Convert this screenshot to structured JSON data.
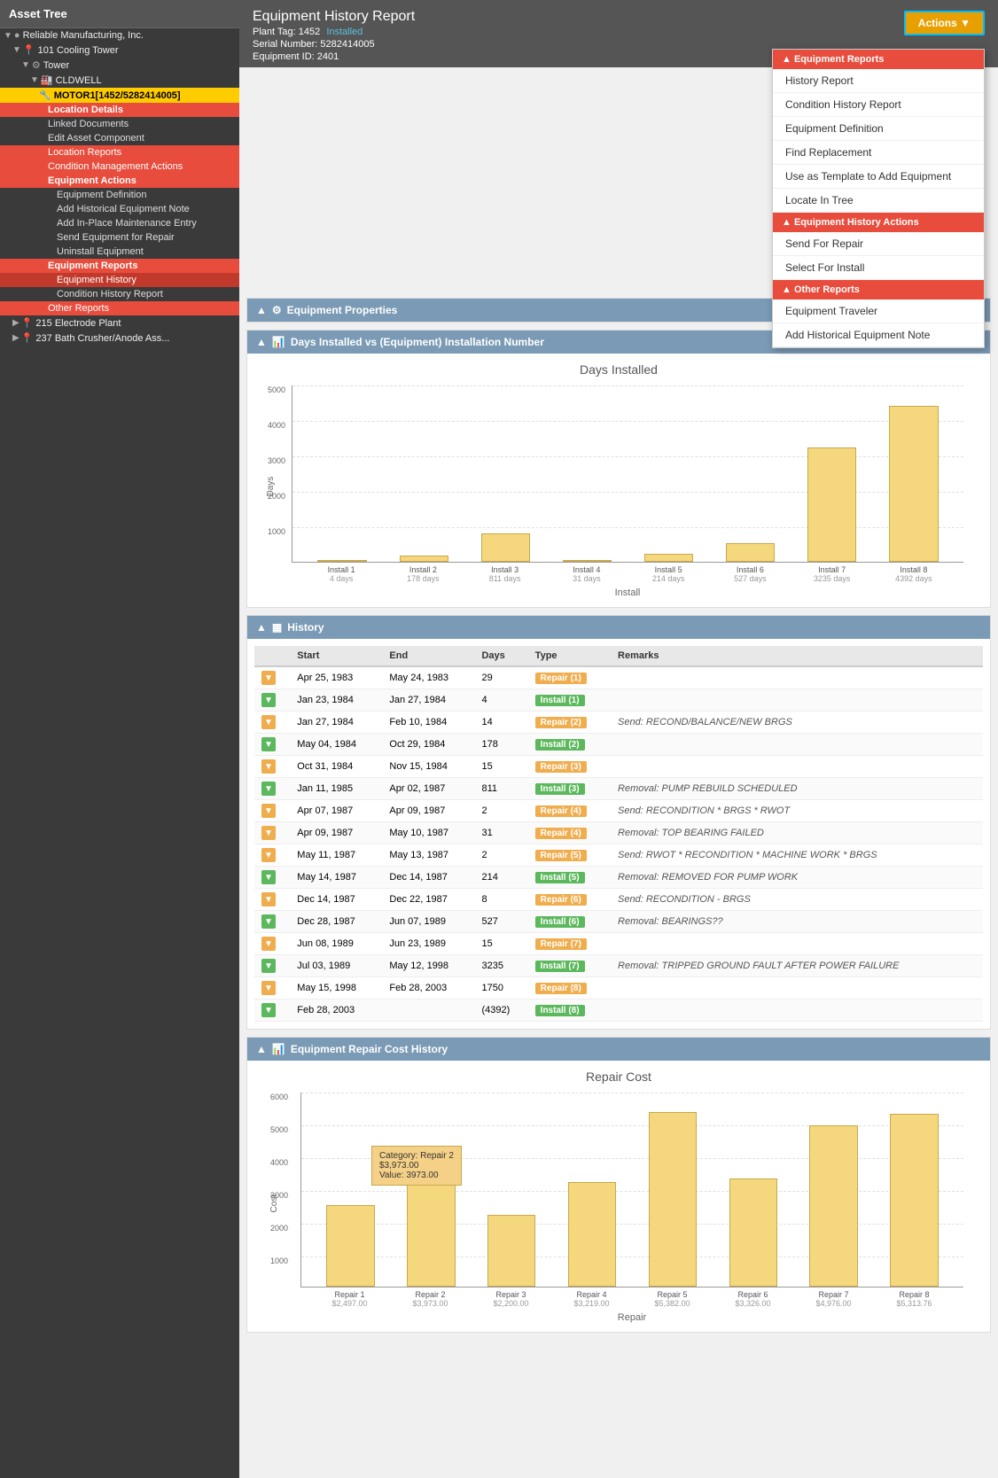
{
  "assetTree": {
    "title": "Asset Tree",
    "items": [
      {
        "id": "reliable",
        "label": "Reliable Manufacturing, Inc.",
        "level": 0,
        "type": "company"
      },
      {
        "id": "cooling",
        "label": "101 Cooling Tower",
        "level": 1,
        "type": "location"
      },
      {
        "id": "tower",
        "label": "Tower",
        "level": 2,
        "type": "group"
      },
      {
        "id": "cldwell",
        "label": "CLDWELL",
        "level": 3,
        "type": "group"
      },
      {
        "id": "motor",
        "label": "MOTOR1[1452/5282414005]",
        "level": 4,
        "type": "equipment",
        "selected": true
      },
      {
        "id": "loc-details",
        "label": "Location Details",
        "level": 5,
        "type": "category-red"
      },
      {
        "id": "linked-docs",
        "label": "Linked Documents",
        "level": 5,
        "type": "plain"
      },
      {
        "id": "edit-asset",
        "label": "Edit Asset Component",
        "level": 5,
        "type": "plain"
      },
      {
        "id": "loc-reports",
        "label": "Location Reports",
        "level": 5,
        "type": "category-red"
      },
      {
        "id": "cond-mgmt",
        "label": "Condition Management Actions",
        "level": 5,
        "type": "category-red"
      },
      {
        "id": "equip-actions",
        "label": "Equipment Actions",
        "level": 5,
        "type": "category-red"
      },
      {
        "id": "equip-def",
        "label": "Equipment Definition",
        "level": 6,
        "type": "plain"
      },
      {
        "id": "add-hist-note",
        "label": "Add Historical Equipment Note",
        "level": 6,
        "type": "plain"
      },
      {
        "id": "add-inplace",
        "label": "Add In-Place Maintenance Entry",
        "level": 6,
        "type": "plain"
      },
      {
        "id": "send-repair",
        "label": "Send Equipment for Repair",
        "level": 6,
        "type": "plain"
      },
      {
        "id": "uninstall",
        "label": "Uninstall Equipment",
        "level": 6,
        "type": "plain"
      },
      {
        "id": "equip-reports",
        "label": "Equipment Reports",
        "level": 5,
        "type": "category-red"
      },
      {
        "id": "equip-history",
        "label": "Equipment History",
        "level": 6,
        "type": "active"
      },
      {
        "id": "cond-history",
        "label": "Condition History Report",
        "level": 6,
        "type": "plain"
      },
      {
        "id": "other-reports",
        "label": "Other Reports",
        "level": 5,
        "type": "category-red"
      },
      {
        "id": "electrode",
        "label": "215 Electrode Plant",
        "level": 1,
        "type": "location"
      },
      {
        "id": "bath-crusher",
        "label": "237 Bath Crusher/Anode Ass...",
        "level": 1,
        "type": "location"
      }
    ]
  },
  "header": {
    "title": "Equipment History Report",
    "plantTag": "Plant Tag: 1452",
    "installed": "Installed",
    "serialNumber": "Serial Number: 5282414005",
    "equipmentId": "Equipment ID: 2401",
    "actionsLabel": "Actions ▼"
  },
  "dropdownMenu": {
    "equipmentReports": {
      "header": "▲ Equipment Reports",
      "items": [
        "History Report",
        "Condition History Report",
        "Equipment Definition",
        "Find Replacement",
        "Use as Template to Add Equipment",
        "Locate In Tree"
      ]
    },
    "equipmentHistoryActions": {
      "header": "▲ Equipment History Actions",
      "items": [
        "Send For Repair",
        "Select For Install"
      ]
    },
    "otherReports": {
      "header": "▲ Other Reports",
      "items": [
        "Equipment Traveler",
        "Add Historical Equipment Note"
      ]
    }
  },
  "equipmentProperties": {
    "sectionTitle": "Equipment Properties",
    "arrow": "▲"
  },
  "daysInstalled": {
    "sectionTitle": "Days Installed vs (Equipment) Installation Number",
    "arrow": "▲",
    "chartTitle": "Days Installed",
    "yAxisLabel": "Days",
    "xAxisLabel": "Install",
    "yTicks": [
      "5000",
      "4000",
      "3000",
      "2000",
      "1000",
      "0"
    ],
    "bars": [
      {
        "label": "Install 1",
        "sublabel": "4 days",
        "value": 4,
        "max": 5000
      },
      {
        "label": "Install 2",
        "sublabel": "178 days",
        "value": 178,
        "max": 5000
      },
      {
        "label": "Install 3",
        "sublabel": "811 days",
        "value": 811,
        "max": 5000
      },
      {
        "label": "Install 4",
        "sublabel": "31 days",
        "value": 31,
        "max": 5000
      },
      {
        "label": "Install 5",
        "sublabel": "214 days",
        "value": 214,
        "max": 5000
      },
      {
        "label": "Install 6",
        "sublabel": "527 days",
        "value": 527,
        "max": 5000
      },
      {
        "label": "Install 7",
        "sublabel": "3235 days",
        "value": 3235,
        "max": 5000
      },
      {
        "label": "Install 8",
        "sublabel": "4392 days",
        "value": 4392,
        "max": 5000
      }
    ]
  },
  "history": {
    "sectionTitle": "History",
    "arrow": "▲",
    "columns": [
      "",
      "Start",
      "End",
      "Days",
      "Type",
      "Remarks"
    ],
    "rows": [
      {
        "toggle": "repair",
        "start": "Apr 25, 1983",
        "end": "May 24, 1983",
        "days": "29",
        "type": "Repair (1)",
        "typeClass": "repair",
        "remarks": ""
      },
      {
        "toggle": "install",
        "start": "Jan 23, 1984",
        "end": "Jan 27, 1984",
        "days": "4",
        "type": "Install (1)",
        "typeClass": "install",
        "remarks": ""
      },
      {
        "toggle": "repair",
        "start": "Jan 27, 1984",
        "end": "Feb 10, 1984",
        "days": "14",
        "type": "Repair (2)",
        "typeClass": "repair",
        "remarks": "Send: RECOND/BALANCE/NEW BRGS"
      },
      {
        "toggle": "install",
        "start": "May 04, 1984",
        "end": "Oct 29, 1984",
        "days": "178",
        "type": "Install (2)",
        "typeClass": "install",
        "remarks": ""
      },
      {
        "toggle": "repair",
        "start": "Oct 31, 1984",
        "end": "Nov 15, 1984",
        "days": "15",
        "type": "Repair (3)",
        "typeClass": "repair",
        "remarks": ""
      },
      {
        "toggle": "install",
        "start": "Jan 11, 1985",
        "end": "Apr 02, 1987",
        "days": "811",
        "type": "Install (3)",
        "typeClass": "install",
        "remarks": "Removal: PUMP REBUILD SCHEDULED"
      },
      {
        "toggle": "repair",
        "start": "Apr 07, 1987",
        "end": "Apr 09, 1987",
        "days": "2",
        "type": "Repair (4)",
        "typeClass": "repair",
        "remarks": "Send: RECONDITION * BRGS * RWOT"
      },
      {
        "toggle": "repair",
        "start": "Apr 09, 1987",
        "end": "May 10, 1987",
        "days": "31",
        "type": "Repair (4)",
        "typeClass": "repair",
        "remarks": "Removal: TOP BEARING FAILED"
      },
      {
        "toggle": "repair",
        "start": "May 11, 1987",
        "end": "May 13, 1987",
        "days": "2",
        "type": "Repair (5)",
        "typeClass": "repair",
        "remarks": "Send: RWOT * RECONDITION * MACHINE WORK * BRGS"
      },
      {
        "toggle": "install",
        "start": "May 14, 1987",
        "end": "Dec 14, 1987",
        "days": "214",
        "type": "Install (5)",
        "typeClass": "install",
        "remarks": "Removal: REMOVED FOR PUMP WORK"
      },
      {
        "toggle": "repair",
        "start": "Dec 14, 1987",
        "end": "Dec 22, 1987",
        "days": "8",
        "type": "Repair (6)",
        "typeClass": "repair",
        "remarks": "Send: RECONDITION - BRGS"
      },
      {
        "toggle": "install",
        "start": "Dec 28, 1987",
        "end": "Jun 07, 1989",
        "days": "527",
        "type": "Install (6)",
        "typeClass": "install",
        "remarks": "Removal: BEARINGS??"
      },
      {
        "toggle": "repair",
        "start": "Jun 08, 1989",
        "end": "Jun 23, 1989",
        "days": "15",
        "type": "Repair (7)",
        "typeClass": "repair",
        "remarks": ""
      },
      {
        "toggle": "install",
        "start": "Jul 03, 1989",
        "end": "May 12, 1998",
        "days": "3235",
        "type": "Install (7)",
        "typeClass": "install",
        "remarks": "Removal: TRIPPED GROUND FAULT AFTER POWER FAILURE"
      },
      {
        "toggle": "repair",
        "start": "May 15, 1998",
        "end": "Feb 28, 2003",
        "days": "1750",
        "type": "Repair (8)",
        "typeClass": "repair",
        "remarks": ""
      },
      {
        "toggle": "install",
        "start": "Feb 28, 2003",
        "end": "",
        "days": "(4392)",
        "type": "Install (8)",
        "typeClass": "install",
        "remarks": ""
      }
    ]
  },
  "repairCost": {
    "sectionTitle": "Equipment Repair Cost History",
    "arrow": "▲",
    "chartTitle": "Repair Cost",
    "yAxisLabel": "Cost",
    "xAxisLabel": "Repair",
    "yTicks": [
      "6000",
      "5000",
      "4000",
      "3000",
      "2000",
      "1000",
      "0"
    ],
    "tooltip": {
      "category": "Category: Repair 2",
      "value": "$3,973.00",
      "valueLabel": "Value: 3973.00"
    },
    "bars": [
      {
        "label": "Repair 1",
        "sublabel": "$2,497.00",
        "value": 2497,
        "max": 6000
      },
      {
        "label": "Repair 2",
        "sublabel": "$3,973.00",
        "value": 3973,
        "max": 6000
      },
      {
        "label": "Repair 3",
        "sublabel": "$2,200.00",
        "value": 2200,
        "max": 6000
      },
      {
        "label": "Repair 4",
        "sublabel": "$3,219.00",
        "value": 3219,
        "max": 6000
      },
      {
        "label": "Repair 5",
        "sublabel": "$5,382.00",
        "value": 5382,
        "max": 6000
      },
      {
        "label": "Repair 6",
        "sublabel": "$3,326.00",
        "value": 3326,
        "max": 6000
      },
      {
        "label": "Repair 7",
        "sublabel": "$4,976.00",
        "value": 4976,
        "max": 6000
      },
      {
        "label": "Repair 8",
        "sublabel": "$5,313.76",
        "value": 5314,
        "max": 6000
      }
    ]
  }
}
